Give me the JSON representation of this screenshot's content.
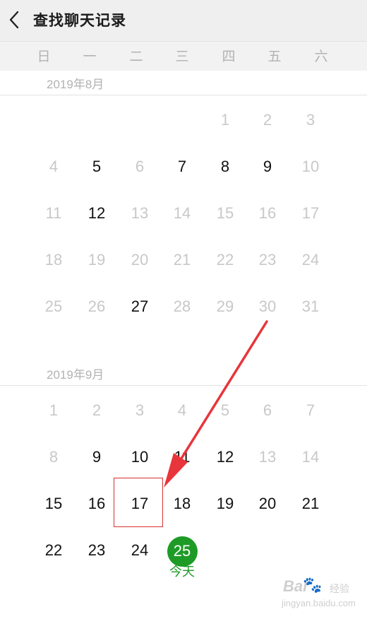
{
  "header": {
    "title": "查找聊天记录"
  },
  "weekdays": [
    "日",
    "一",
    "二",
    "三",
    "四",
    "五",
    "六"
  ],
  "months": [
    {
      "label": "2019年8月",
      "weeks": [
        [
          null,
          null,
          null,
          null,
          {
            "d": "1",
            "active": false
          },
          {
            "d": "2",
            "active": false
          },
          {
            "d": "3",
            "active": false
          }
        ],
        [
          {
            "d": "4",
            "active": false
          },
          {
            "d": "5",
            "active": true
          },
          {
            "d": "6",
            "active": false
          },
          {
            "d": "7",
            "active": true
          },
          {
            "d": "8",
            "active": true
          },
          {
            "d": "9",
            "active": true
          },
          {
            "d": "10",
            "active": false
          }
        ],
        [
          {
            "d": "11",
            "active": false
          },
          {
            "d": "12",
            "active": true
          },
          {
            "d": "13",
            "active": false
          },
          {
            "d": "14",
            "active": false
          },
          {
            "d": "15",
            "active": false
          },
          {
            "d": "16",
            "active": false
          },
          {
            "d": "17",
            "active": false
          }
        ],
        [
          {
            "d": "18",
            "active": false
          },
          {
            "d": "19",
            "active": false
          },
          {
            "d": "20",
            "active": false
          },
          {
            "d": "21",
            "active": false
          },
          {
            "d": "22",
            "active": false
          },
          {
            "d": "23",
            "active": false
          },
          {
            "d": "24",
            "active": false
          }
        ],
        [
          {
            "d": "25",
            "active": false
          },
          {
            "d": "26",
            "active": false
          },
          {
            "d": "27",
            "active": true
          },
          {
            "d": "28",
            "active": false
          },
          {
            "d": "29",
            "active": false
          },
          {
            "d": "30",
            "active": false
          },
          {
            "d": "31",
            "active": false
          }
        ]
      ]
    },
    {
      "label": "2019年9月",
      "weeks": [
        [
          {
            "d": "1",
            "active": false
          },
          {
            "d": "2",
            "active": false
          },
          {
            "d": "3",
            "active": false
          },
          {
            "d": "4",
            "active": false
          },
          {
            "d": "5",
            "active": false
          },
          {
            "d": "6",
            "active": false
          },
          {
            "d": "7",
            "active": false
          }
        ],
        [
          {
            "d": "8",
            "active": false
          },
          {
            "d": "9",
            "active": true
          },
          {
            "d": "10",
            "active": true
          },
          {
            "d": "11",
            "active": true
          },
          {
            "d": "12",
            "active": true
          },
          {
            "d": "13",
            "active": false
          },
          {
            "d": "14",
            "active": false
          }
        ],
        [
          {
            "d": "15",
            "active": true
          },
          {
            "d": "16",
            "active": true
          },
          {
            "d": "17",
            "active": true
          },
          {
            "d": "18",
            "active": true
          },
          {
            "d": "19",
            "active": true
          },
          {
            "d": "20",
            "active": true
          },
          {
            "d": "21",
            "active": true
          }
        ],
        [
          {
            "d": "22",
            "active": true
          },
          {
            "d": "23",
            "active": true
          },
          {
            "d": "24",
            "active": true
          },
          null,
          null,
          null,
          null
        ]
      ]
    }
  ],
  "today": {
    "day": "25",
    "label": "今天"
  },
  "watermark": {
    "brand": "Bai",
    "paw": "🐾",
    "sub": "经验",
    "url": "jingyan.baidu.com"
  },
  "colors": {
    "accent": "#1e9b27",
    "annotation": "#d9312f",
    "active_text": "#111111",
    "inactive_text": "#c8c8c8"
  },
  "icons": {
    "back": "chevron-left-icon"
  }
}
